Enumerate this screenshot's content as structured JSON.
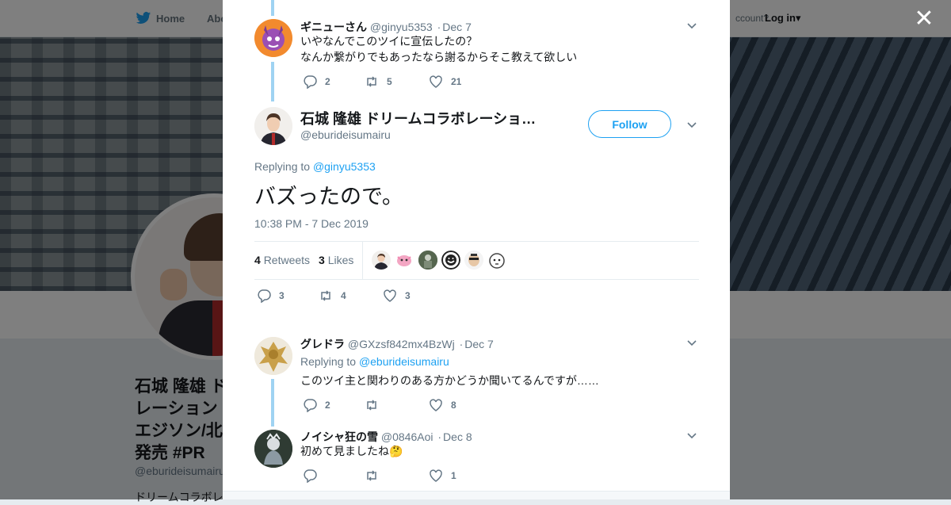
{
  "page": {
    "nav_home": "Home",
    "nav_about": "Abo",
    "nav_account": "ccount?",
    "nav_login": "Log in"
  },
  "profile": {
    "name": "石城 隆雄 ド\nレーション\nエジソン/北\n発売 #PR",
    "handle": "@eburideisumairu",
    "bio": "ドリームコラボレ"
  },
  "tweets": [
    {
      "name": "ギニューさん",
      "handle": "@ginyu5353",
      "date": "Dec 7",
      "lines": [
        "いやなんでこのツイに宣伝したの？",
        "なんか繋がりでもあったなら謝るからそこ教えて欲しい"
      ],
      "replies": "2",
      "retweets": "5",
      "likes": "21"
    }
  ],
  "main_tweet": {
    "name": "石城 隆雄 ドリームコラボレーショ…",
    "handle": "@eburideisumairu",
    "follow_label": "Follow",
    "replying_prefix": "Replying to ",
    "replying_to": "@ginyu5353",
    "text": "バズったので。",
    "timestamp": "10:38 PM - 7 Dec 2019",
    "retweets_count": "4",
    "retweets_label": "Retweets",
    "likes_count": "3",
    "likes_label": "Likes",
    "replies": "3",
    "retweets": "4",
    "likes": "3"
  },
  "replies": [
    {
      "name": "グレドラ",
      "handle": "@GXzsf842mx4BzWj",
      "date": "Dec 7",
      "replying_prefix": "Replying to ",
      "replying_to": "@eburideisumairu",
      "text": "このツイ主と関わりのある方かどうか聞いてるんですが……",
      "replies": "2",
      "retweets": "",
      "likes": "8"
    },
    {
      "name": "ノイシャ狂の雪",
      "handle": "@0846Aoi",
      "date": "Dec 8",
      "text": "初めて見ましたね🤔",
      "replies": "",
      "retweets": "",
      "likes": "1"
    }
  ],
  "icons": [
    "twitter-bird-icon",
    "close-icon",
    "chevron-down-icon",
    "reply-icon",
    "retweet-icon",
    "like-icon"
  ],
  "colors": {
    "accent": "#1da1f2",
    "thread": "#9fd3f2",
    "muted": "#657786"
  }
}
